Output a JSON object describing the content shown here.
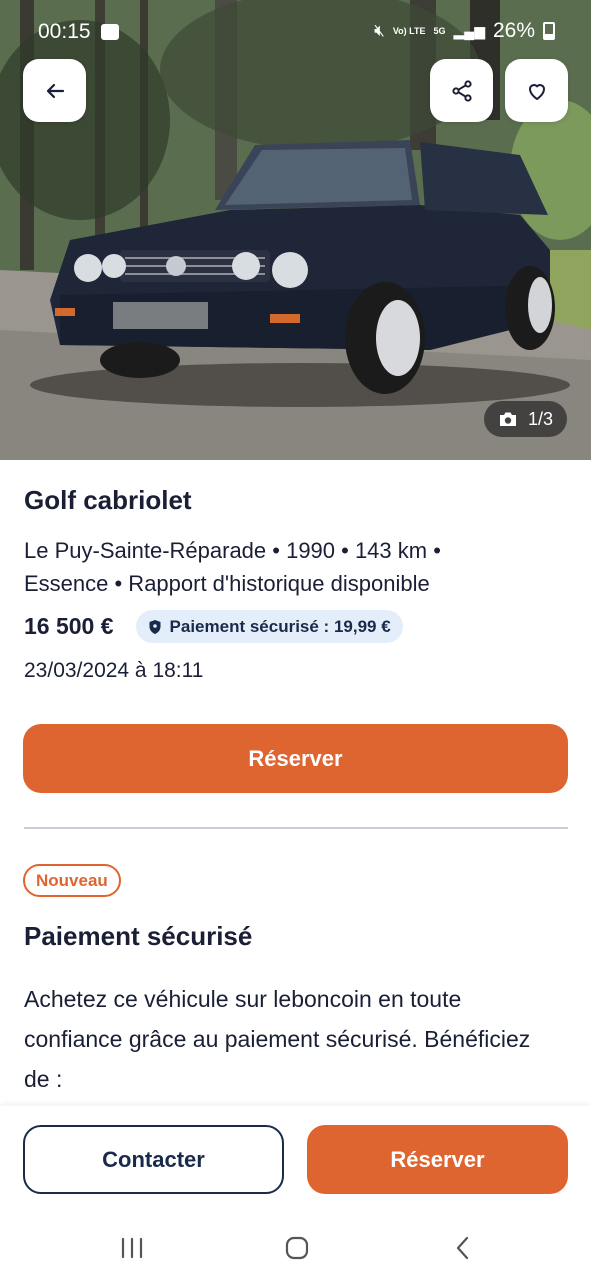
{
  "status_bar": {
    "time": "00:15",
    "volte": "Vo) LTE",
    "network": "5G",
    "battery": "26%"
  },
  "hero": {
    "photo_counter": "1/3",
    "icons": {
      "back": "arrow-left-icon",
      "share": "share-icon",
      "favorite": "heart-icon",
      "camera": "camera-icon"
    }
  },
  "listing": {
    "title": "Golf cabriolet",
    "meta_line_1": "Le Puy-Sainte-Réparade • 1990 • 143 km •",
    "meta_line_2": "Essence • Rapport d'historique disponible",
    "price": "16 500 €",
    "secure_payment_label": "Paiement sécurisé : 19,99 €",
    "date": "23/03/2024 à 18:11",
    "reserve_label": "Réserver"
  },
  "secure_section": {
    "badge": "Nouveau",
    "title": "Paiement sécurisé",
    "body": "Achetez ce véhicule sur leboncoin en toute confiance grâce au paiement sécurisé. Bénéficiez de :"
  },
  "action_bar": {
    "contact_label": "Contacter",
    "reserve_label": "Réserver"
  },
  "colors": {
    "accent": "#df6530",
    "navy": "#1a2a4a",
    "pill_bg": "#e4eefb"
  }
}
